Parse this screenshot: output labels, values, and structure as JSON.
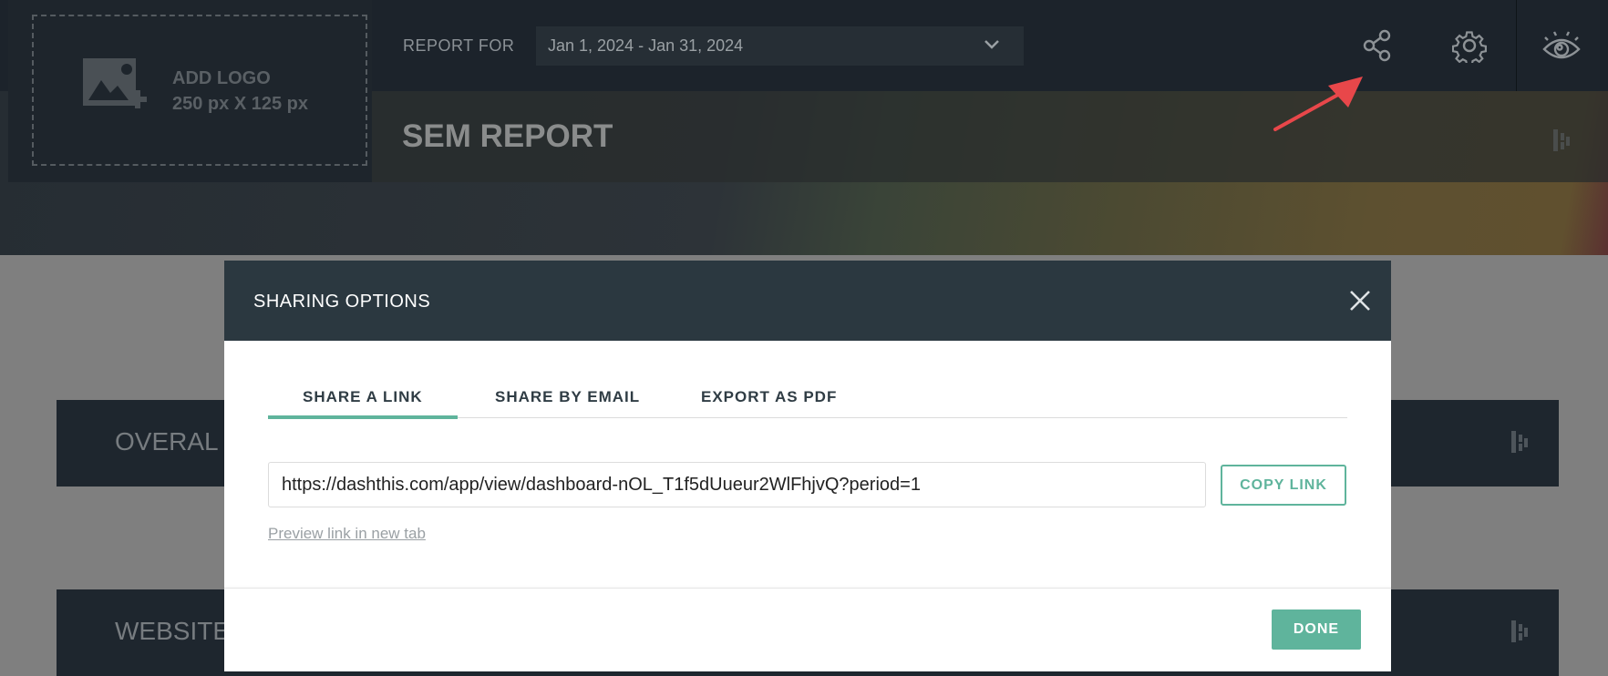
{
  "header": {
    "logo": {
      "title": "ADD LOGO",
      "size": "250 px X 125 px"
    },
    "report_for_label": "REPORT FOR",
    "date_range": "Jan 1, 2024 - Jan 31, 2024",
    "icons": [
      "share-icon",
      "gear-icon",
      "eye-icon"
    ],
    "title": "SEM REPORT"
  },
  "sections": [
    {
      "label": "OVERAL"
    },
    {
      "label": "WEBSITE"
    }
  ],
  "modal": {
    "title": "SHARING OPTIONS",
    "tabs": [
      {
        "label": "SHARE A LINK",
        "active": true
      },
      {
        "label": "SHARE BY EMAIL",
        "active": false
      },
      {
        "label": "EXPORT AS PDF",
        "active": false
      }
    ],
    "link_value": "https://dashthis.com/app/view/dashboard-nOL_T1f5dUueur2WlFhjvQ?period=1",
    "copy_label": "COPY LINK",
    "preview_label": "Preview link in new tab",
    "done_label": "DONE"
  },
  "colors": {
    "accent": "#5fb49c",
    "header": "#1c232b",
    "modal_header": "#2b3840",
    "annotation_arrow": "#e8474a"
  }
}
